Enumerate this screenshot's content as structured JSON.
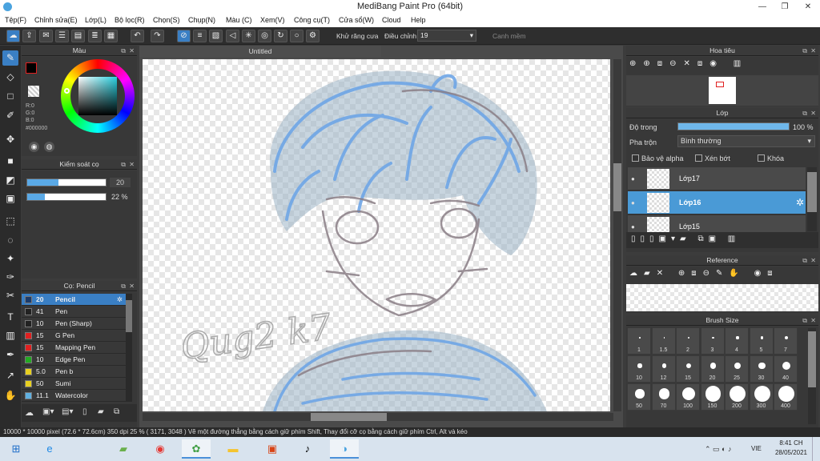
{
  "window": {
    "title": "MediBang Paint Pro (64bit)",
    "min": "—",
    "max": "❐",
    "close": "✕"
  },
  "menu": [
    "Tệp(F)",
    "Chỉnh sửa(E)",
    "Lớp(L)",
    "Bộ lọc(R)",
    "Chọn(S)",
    "Chụp(N)",
    "Màu (C)",
    "Xem(V)",
    "Công cụ(T)",
    "Cửa sổ(W)",
    "Cloud",
    "Help"
  ],
  "toolbar": {
    "antialias_label": "Khử răng cưa",
    "adjust_label": "Điều chỉnh",
    "adjust_value": "19",
    "smooth_label": "Canh mềm"
  },
  "color_panel": {
    "title": "Màu",
    "r": "R:0",
    "g": "G:0",
    "b": "B:0",
    "hex": "#000000",
    "fg_color": "#000000",
    "bg_color": "#ffffff"
  },
  "brush_control": {
    "title": "Kiểm soát cọ",
    "size": "20",
    "opacity": "22 %"
  },
  "brush_list": {
    "title": "Cọ: Pencil",
    "items": [
      {
        "size": "20",
        "name": "Pencil",
        "color": "#1c3b6a",
        "selected": true
      },
      {
        "size": "41",
        "name": "Pen",
        "color": "#222222"
      },
      {
        "size": "10",
        "name": "Pen (Sharp)",
        "color": "#222222"
      },
      {
        "size": "15",
        "name": "G Pen",
        "color": "#e02020"
      },
      {
        "size": "15",
        "name": "Mapping Pen",
        "color": "#e02020"
      },
      {
        "size": "10",
        "name": "Edge Pen",
        "color": "#22aa22"
      },
      {
        "size": "5.0",
        "name": "Pen b",
        "color": "#e8d020"
      },
      {
        "size": "50",
        "name": "Sumi",
        "color": "#e8d020"
      },
      {
        "size": "11.1",
        "name": "Watercolor",
        "color": "#60b0e0"
      }
    ]
  },
  "canvas": {
    "tab": "Untitled",
    "signature": "Qug2 k7"
  },
  "navigator": {
    "title": "Hoa tiêu"
  },
  "layer_panel": {
    "title": "Lớp",
    "opacity_label": "Độ trong",
    "opacity_value": "100 %",
    "opacity_fraction": 1.0,
    "blend_label": "Pha trộn",
    "blend_value": "Bình thường",
    "protect_alpha": "Bảo vệ alpha",
    "clipping": "Xén bớt",
    "lock": "Khóa",
    "layers": [
      {
        "name": "Lớp17",
        "selected": false
      },
      {
        "name": "Lớp16",
        "selected": true
      },
      {
        "name": "Lớp15",
        "selected": false
      }
    ]
  },
  "reference": {
    "title": "Reference"
  },
  "brush_size": {
    "title": "Brush Size",
    "sizes": [
      "1",
      "1.5",
      "2",
      "3",
      "4",
      "5",
      "7",
      "10",
      "12",
      "15",
      "20",
      "25",
      "30",
      "40",
      "50",
      "70",
      "100",
      "150",
      "200",
      "300",
      "400"
    ]
  },
  "status": {
    "text": "10000 * 10000 pixel   (72.6 * 72.6cm)   350 dpi   25 %   ( 3171, 3048 )   Vẽ một đường thẳng bằng cách giữ phím Shift, Thay đổi cỡ cọ bằng cách giữ phím Ctrl, Alt và kéo"
  },
  "taskbar": {
    "time": "8:41 CH",
    "date": "28/05/2021",
    "lang": "VIE"
  }
}
